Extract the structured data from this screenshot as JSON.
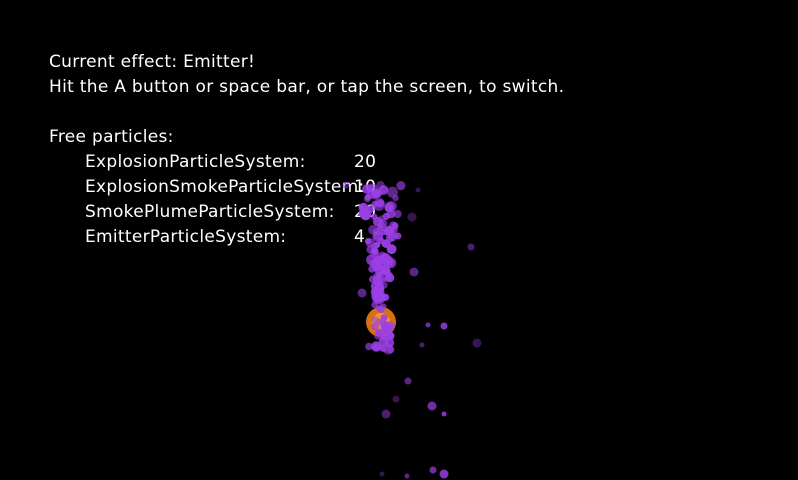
{
  "header": {
    "current_effect": "Current effect: Emitter!",
    "hint": "Hit the A button or space bar, or tap the screen, to switch."
  },
  "free_particles": {
    "title": "Free particles:",
    "rows": [
      {
        "name": "ExplosionParticleSystem:",
        "count": "20"
      },
      {
        "name": "ExplosionSmokeParticleSystem:",
        "count": "10"
      },
      {
        "name": "SmokePlumeParticleSystem:",
        "count": "20"
      },
      {
        "name": "EmitterParticleSystem:",
        "count": "4"
      }
    ]
  },
  "colors": {
    "background": "#000000",
    "text": "#ffffff",
    "particle": "#9b3fe6",
    "emitter": "#f07c14"
  }
}
